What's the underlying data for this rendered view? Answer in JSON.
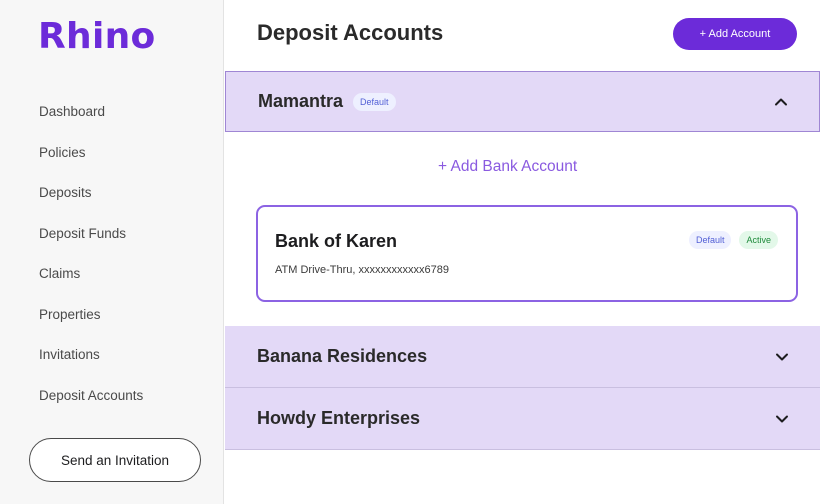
{
  "sidebar": {
    "logo": "Rhino",
    "items": [
      {
        "label": "Dashboard"
      },
      {
        "label": "Policies"
      },
      {
        "label": "Deposits"
      },
      {
        "label": "Deposit Funds"
      },
      {
        "label": "Claims"
      },
      {
        "label": "Properties"
      },
      {
        "label": "Invitations"
      },
      {
        "label": "Deposit Accounts"
      }
    ],
    "invite_button": "Send an Invitation"
  },
  "header": {
    "title": "Deposit Accounts",
    "add_account_button": "+ Add Account"
  },
  "accounts": [
    {
      "name": "Mamantra",
      "badge": "Default",
      "expanded": true,
      "chevron_icon": "chevron-up-icon",
      "add_bank_link": "+ Add Bank Account",
      "bank": {
        "name": "Bank of Karen",
        "detail": "ATM Drive-Thru, xxxxxxxxxxxx6789",
        "badge_default": "Default",
        "badge_active": "Active"
      }
    },
    {
      "name": "Banana Residences",
      "expanded": false,
      "chevron_icon": "chevron-down-icon"
    },
    {
      "name": "Howdy Enterprises",
      "expanded": false,
      "chevron_icon": "chevron-down-icon"
    }
  ],
  "colors": {
    "brand": "#6c2bd9",
    "accordion_bg": "#e3d9f7",
    "card_border": "#8c63e3",
    "badge_default_bg": "#eef0ff",
    "badge_active_bg": "#e3f8e9"
  }
}
